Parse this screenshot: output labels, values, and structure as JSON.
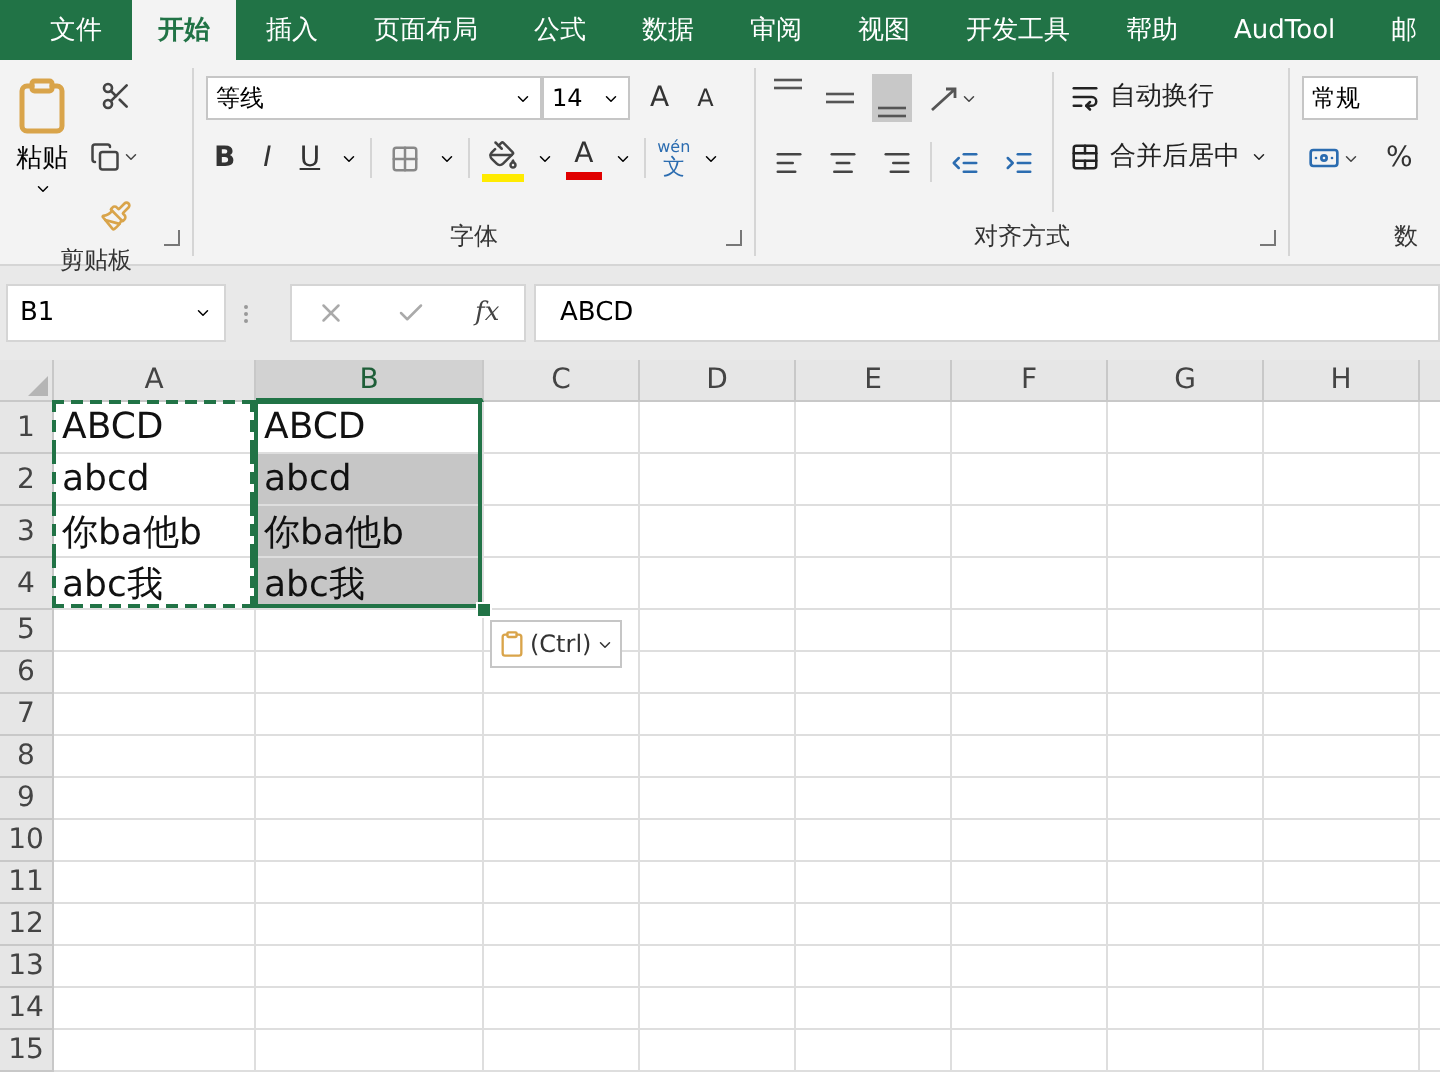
{
  "tabs": [
    {
      "label": "文件",
      "selected": false
    },
    {
      "label": "开始",
      "selected": true
    },
    {
      "label": "插入",
      "selected": false
    },
    {
      "label": "页面布局",
      "selected": false
    },
    {
      "label": "公式",
      "selected": false
    },
    {
      "label": "数据",
      "selected": false
    },
    {
      "label": "审阅",
      "selected": false
    },
    {
      "label": "视图",
      "selected": false
    },
    {
      "label": "开发工具",
      "selected": false
    },
    {
      "label": "帮助",
      "selected": false
    },
    {
      "label": "AudTool",
      "selected": false
    },
    {
      "label": "邮",
      "selected": false
    }
  ],
  "clipboard": {
    "paste_label": "粘贴",
    "group_label": "剪贴板"
  },
  "font": {
    "font_name": "等线",
    "font_size": "14",
    "grow": "A",
    "shrink": "A",
    "bold": "B",
    "italic": "I",
    "underline": "U",
    "font_color": "A",
    "phonetic_top": "wén",
    "phonetic_bottom": "文",
    "group_label": "字体"
  },
  "alignment": {
    "vertical": [
      {
        "kind": "top",
        "selected": false
      },
      {
        "kind": "middle",
        "selected": false
      },
      {
        "kind": "bottom",
        "selected": true
      }
    ],
    "wrap_text": "自动换行",
    "merge_center": "合并后居中",
    "group_label": "对齐方式"
  },
  "number": {
    "format": "常规",
    "percent": "%",
    "group_label": "数"
  },
  "name_box": "B1",
  "insert_function": "fx",
  "formula": "ABCD",
  "columns": [
    {
      "label": "A",
      "selected": false
    },
    {
      "label": "B",
      "selected": true
    },
    {
      "label": "C",
      "selected": false
    },
    {
      "label": "D",
      "selected": false
    },
    {
      "label": "E",
      "selected": false
    },
    {
      "label": "F",
      "selected": false
    },
    {
      "label": "G",
      "selected": false
    },
    {
      "label": "H",
      "selected": false
    }
  ],
  "rows": [
    {
      "label": "1",
      "cells": [
        {
          "text": "ABCD",
          "copied": true,
          "selected": false
        },
        {
          "text": "ABCD",
          "copied": false,
          "selected": true
        }
      ]
    },
    {
      "label": "2",
      "cells": [
        {
          "text": "abcd",
          "copied": true,
          "selected": false
        },
        {
          "text": "abcd",
          "copied": false,
          "selected": true
        }
      ]
    },
    {
      "label": "3",
      "cells": [
        {
          "text": "你ba他b",
          "copied": true,
          "selected": false
        },
        {
          "text": "你ba他b",
          "copied": false,
          "selected": true
        }
      ]
    },
    {
      "label": "4",
      "cells": [
        {
          "text": "abc我",
          "copied": true,
          "selected": false
        },
        {
          "text": "abc我",
          "copied": false,
          "selected": true
        }
      ]
    },
    {
      "label": "5",
      "cells": []
    },
    {
      "label": "6",
      "cells": []
    },
    {
      "label": "7",
      "cells": []
    },
    {
      "label": "8",
      "cells": []
    },
    {
      "label": "9",
      "cells": []
    },
    {
      "label": "10",
      "cells": []
    },
    {
      "label": "11",
      "cells": []
    },
    {
      "label": "12",
      "cells": []
    },
    {
      "label": "13",
      "cells": []
    },
    {
      "label": "14",
      "cells": []
    },
    {
      "label": "15",
      "cells": []
    }
  ],
  "paste_options": "(Ctrl)"
}
